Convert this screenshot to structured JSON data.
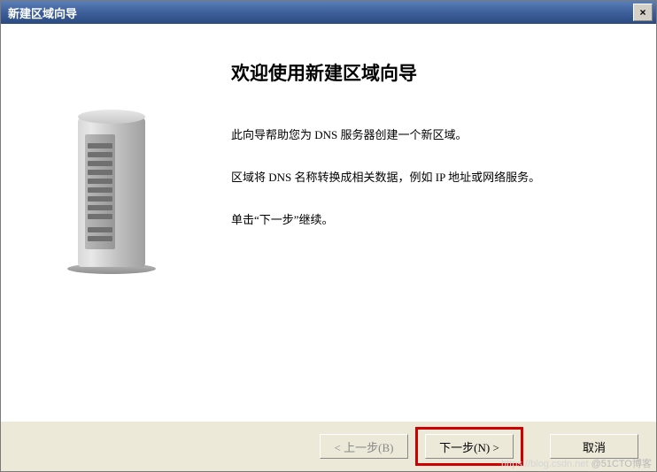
{
  "titlebar": {
    "title": "新建区域向导",
    "close": "×"
  },
  "wizard": {
    "heading": "欢迎使用新建区域向导",
    "line1": "此向导帮助您为 DNS 服务器创建一个新区域。",
    "line2": "区域将 DNS 名称转换成相关数据，例如 IP 地址或网络服务。",
    "line3": "单击“下一步”继续。"
  },
  "buttons": {
    "back": "< 上一步(B)",
    "next": "下一步(N) >",
    "cancel": "取消"
  },
  "watermark": {
    "faint": "https://blog.csdn.net",
    "main": "@51CTO博客"
  }
}
